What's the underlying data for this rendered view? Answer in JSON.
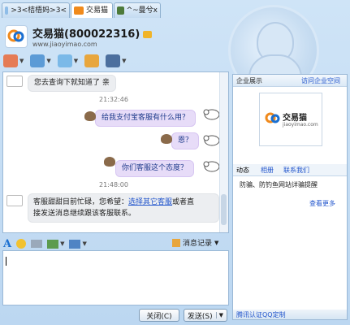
{
  "tabs": [
    {
      "label": ">3<桔梧妈>3<",
      "active": false
    },
    {
      "label": "交易猫",
      "active": true
    },
    {
      "label": "^~曼兮x",
      "active": false
    }
  ],
  "header": {
    "title": "交易猫(800022316)",
    "url": "www.jiaoyimao.com"
  },
  "chat": {
    "messages": [
      {
        "type": "in",
        "text": "您去查询下就知道了 亲"
      },
      {
        "type": "time",
        "text": "21:32:46"
      },
      {
        "type": "out",
        "text": "给我支付宝客服有什么用？"
      },
      {
        "type": "out",
        "text": "恩？"
      },
      {
        "type": "out",
        "text": "你们客服这个态度？"
      },
      {
        "type": "time",
        "text": "21:48:00"
      },
      {
        "type": "in",
        "line1_prefix": "客服甜甜目前忙碌，您希望：",
        "line1_link": "选择其它客服",
        "line1_suffix": "或者直",
        "line2": "接发送消息继续跟该客服联系。"
      }
    ]
  },
  "input_toolbar": {
    "message_record_label": "消息记录"
  },
  "buttons": {
    "close_label": "关闭(C)",
    "send_label": "发送(S)"
  },
  "right_panel": {
    "title": "企业展示",
    "link": "访问企业空间",
    "logo_text": "交易猫",
    "logo_url": "jiaoyimao.com",
    "tabs": [
      "动态",
      "相册",
      "联系我们"
    ],
    "news": "防骗、防钓鱼网站详骗提醒",
    "more": "查看更多",
    "footer": "腾讯认证QQ定制"
  },
  "colors": {
    "accent": "#2255cc",
    "out_bubble": "#e7dcf8",
    "in_bubble": "#eceef1",
    "logo_orange": "#f08a1c",
    "logo_blue": "#1a6fd1"
  }
}
